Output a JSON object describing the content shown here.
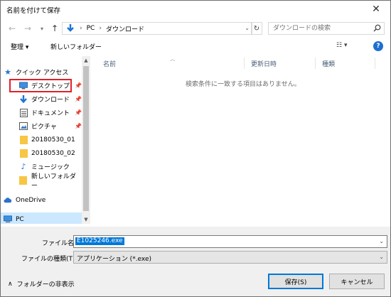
{
  "window": {
    "title": "名前を付けて保存"
  },
  "nav": {
    "breadcrumb": [
      "PC",
      "ダウンロード"
    ],
    "search_placeholder": "ダウンロードの検索"
  },
  "toolbar": {
    "organize": "整理 ▾",
    "new_folder": "新しいフォルダー"
  },
  "sidebar": {
    "items": [
      {
        "label": "クイック アクセス",
        "icon": "star-icon"
      },
      {
        "label": "デスクトップ",
        "icon": "desktop-icon",
        "pinned": true
      },
      {
        "label": "ダウンロード",
        "icon": "download-icon",
        "pinned": true
      },
      {
        "label": "ドキュメント",
        "icon": "document-icon",
        "pinned": true
      },
      {
        "label": "ピクチャ",
        "icon": "picture-icon",
        "pinned": true
      },
      {
        "label": "20180530_01",
        "icon": "folder-icon"
      },
      {
        "label": "20180530_02",
        "icon": "folder-icon"
      },
      {
        "label": "ミュージック",
        "icon": "music-icon"
      },
      {
        "label": "新しいフォルダー",
        "icon": "folder-icon"
      },
      {
        "label": "OneDrive",
        "icon": "cloud-icon"
      },
      {
        "label": "PC",
        "icon": "pc-icon"
      }
    ]
  },
  "columns": [
    "名前",
    "更新日時",
    "種類"
  ],
  "empty_message": "検索条件に一致する項目はありません。",
  "footer": {
    "filename_label": "ファイル名(N):",
    "filename_value": "E1025246.exe",
    "filetype_label": "ファイルの種類(T):",
    "filetype_value": "アプリケーション (*.exe)",
    "hide_folders": "フォルダーの非表示",
    "save": "保存(S)",
    "cancel": "キャンセル"
  },
  "colors": {
    "accent": "#0078d7",
    "highlight_box": "#e0202a",
    "selected_bg": "#cce8ff"
  }
}
